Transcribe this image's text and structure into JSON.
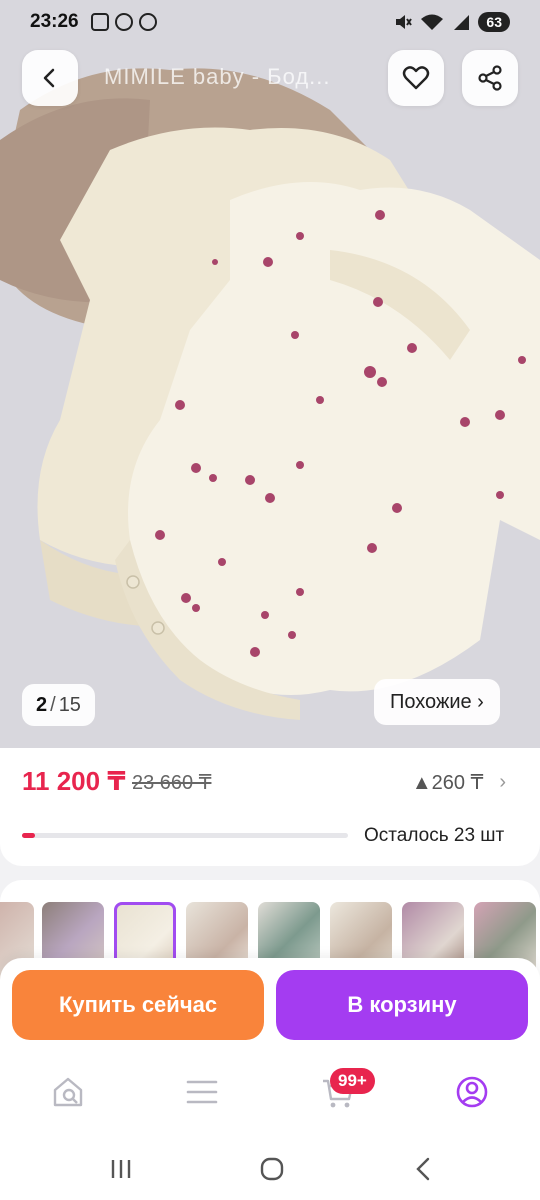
{
  "status_bar": {
    "time": "23:26",
    "battery": "63"
  },
  "product": {
    "title": "MIMILE baby - Бод...",
    "image_index": "2",
    "image_separator": "/",
    "image_total": "15",
    "similar_label": "Похожие ›",
    "price": "11 200 ₸",
    "old_price": "23 660 ₸",
    "bonus": "▲260 ₸",
    "bonus_chevron": "›",
    "stock_fraction": 0.04,
    "remaining_text": "Осталось 23 шт"
  },
  "actions": {
    "buy_now": "Купить сейчас",
    "add_to_cart": "В корзину"
  },
  "bottom_nav": {
    "items": [
      {
        "icon": "home-search-icon"
      },
      {
        "icon": "catalog-menu-icon"
      },
      {
        "icon": "cart-icon"
      },
      {
        "icon": "profile-icon"
      }
    ],
    "cart_badge": "99+"
  },
  "colors": {
    "accent_red": "#e8254e",
    "buy_orange": "#f9843b",
    "cart_purple": "#a43cf1"
  }
}
